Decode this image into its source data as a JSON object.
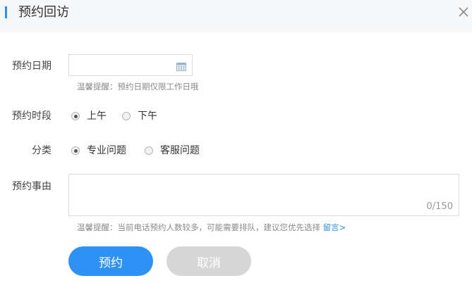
{
  "dialog": {
    "title": "预约回访",
    "close_icon": "close-icon"
  },
  "form": {
    "date": {
      "label": "预约日期",
      "value": "",
      "icon": "calendar-icon",
      "hint": "温馨提醒：预约日期仅限工作日哦"
    },
    "period": {
      "label": "预约时段",
      "options": [
        {
          "label": "上午",
          "checked": true
        },
        {
          "label": "下午",
          "checked": false
        }
      ]
    },
    "category": {
      "label": "分类",
      "options": [
        {
          "label": "专业问题",
          "checked": true
        },
        {
          "label": "客服问题",
          "checked": false
        }
      ]
    },
    "reason": {
      "label": "预约事由",
      "value": "",
      "counter": "0/150",
      "hint": "温馨提醒：当前电话预约人数较多，可能需要排队，建议您优先选择",
      "hint_link": "留言>"
    }
  },
  "actions": {
    "submit_label": "预约",
    "cancel_label": "取消"
  },
  "colors": {
    "accent": "#2e8fe8",
    "primary_button": "#2e92f4",
    "disabled_button": "#d6d6d6"
  }
}
